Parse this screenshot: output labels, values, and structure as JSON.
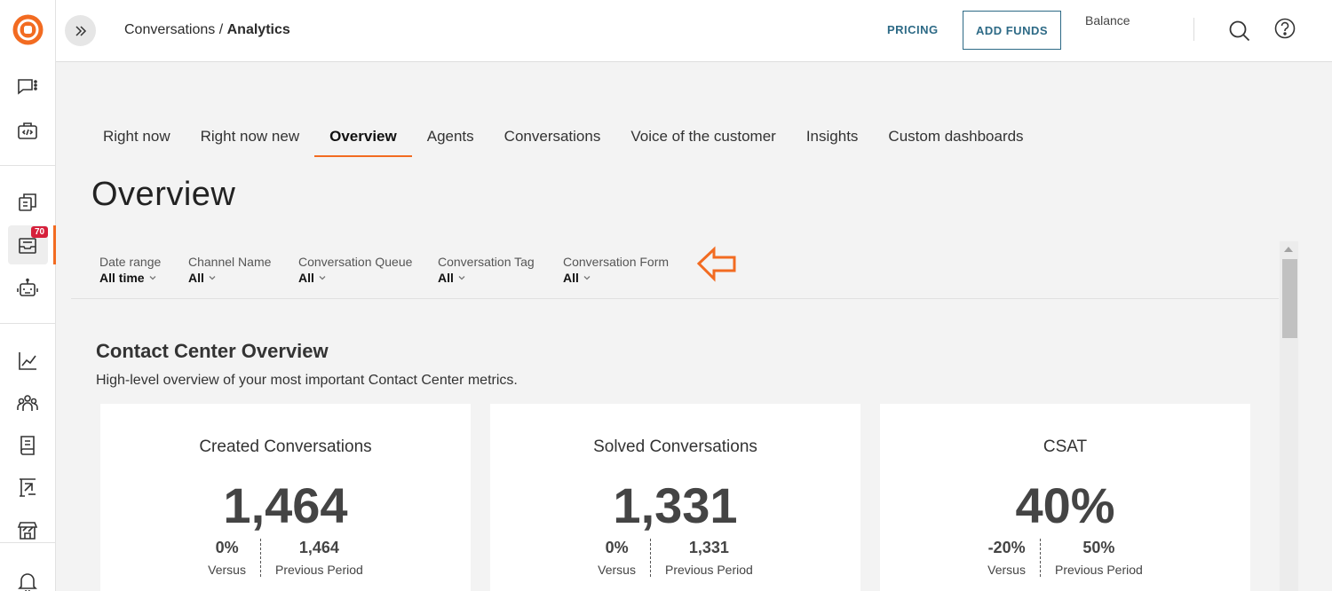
{
  "header": {
    "breadcrumb_parent": "Conversations",
    "breadcrumb_sep": " / ",
    "breadcrumb_current": "Analytics",
    "pricing_label": "PRICING",
    "add_funds_label": "ADD FUNDS",
    "balance_label": "Balance"
  },
  "sidebar": {
    "items": [
      {
        "icon": "chat-icon"
      },
      {
        "icon": "code-icon"
      },
      {
        "icon": "conversations-icon"
      },
      {
        "icon": "inbox-icon",
        "badge": "70",
        "active": true
      },
      {
        "icon": "bot-icon"
      },
      {
        "icon": "analytics-icon"
      },
      {
        "icon": "people-icon"
      },
      {
        "icon": "book-icon"
      },
      {
        "icon": "report-icon"
      },
      {
        "icon": "store-icon"
      },
      {
        "icon": "bell-icon"
      }
    ],
    "accent_color": "#f26b21",
    "badge_color": "#d6203b"
  },
  "tabs": [
    {
      "label": "Right now"
    },
    {
      "label": "Right now new"
    },
    {
      "label": "Overview",
      "active": true
    },
    {
      "label": "Agents"
    },
    {
      "label": "Conversations"
    },
    {
      "label": "Voice of the customer"
    },
    {
      "label": "Insights"
    },
    {
      "label": "Custom dashboards"
    }
  ],
  "page_title": "Overview",
  "filters": [
    {
      "label": "Date range",
      "value": "All time"
    },
    {
      "label": "Channel Name",
      "value": "All"
    },
    {
      "label": "Conversation Queue",
      "value": "All"
    },
    {
      "label": "Conversation Tag",
      "value": "All"
    },
    {
      "label": "Conversation Form",
      "value": "All"
    }
  ],
  "section": {
    "title": "Contact Center Overview",
    "subtitle": "High-level overview of your most important Contact Center metrics."
  },
  "cards": [
    {
      "title": "Created Conversations",
      "value": "1,464",
      "versus_value": "0%",
      "versus_label": "Versus",
      "prev_value": "1,464",
      "prev_label": "Previous Period"
    },
    {
      "title": "Solved Conversations",
      "value": "1,331",
      "versus_value": "0%",
      "versus_label": "Versus",
      "prev_value": "1,331",
      "prev_label": "Previous Period"
    },
    {
      "title": "CSAT",
      "value": "40%",
      "versus_value": "-20%",
      "versus_label": "Versus",
      "prev_value": "50%",
      "prev_label": "Previous Period"
    }
  ],
  "colors": {
    "link": "#2d6a86",
    "hint_arrow": "#f26b21"
  }
}
